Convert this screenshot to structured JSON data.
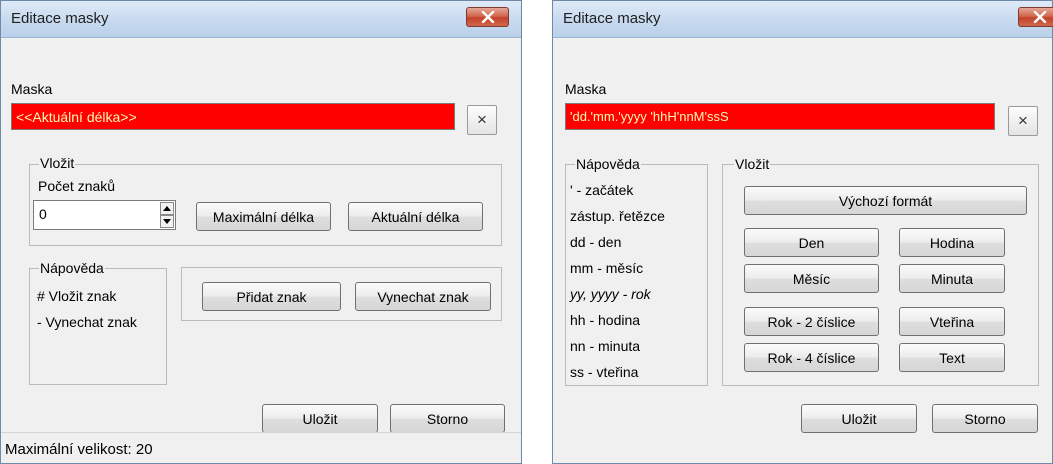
{
  "left_dialog": {
    "title": "Editace masky",
    "mask_label": "Maska",
    "mask_value": "<<Aktuální délka>>",
    "clear_button": "×",
    "insert_group": {
      "legend": "Vložit",
      "count_label": "Počet znaků",
      "count_value": "0",
      "max_length_button": "Maximální délka",
      "current_length_button": "Aktuální délka"
    },
    "help_group": {
      "legend": "Nápověda",
      "lines": [
        "# Vložit znak",
        "- Vynechat znak"
      ]
    },
    "add_char_button": "Přidat znak",
    "skip_char_button": "Vynechat znak",
    "save_button": "Uložit",
    "cancel_button": "Storno",
    "status_text": "Maximální velikost: 20"
  },
  "right_dialog": {
    "title": "Editace masky",
    "mask_label": "Maska",
    "mask_value": "'dd.'mm.'yyyy 'hhH'nnM'ssS",
    "clear_button": "×",
    "help_group": {
      "legend": "Nápověda",
      "lines": [
        "' - začátek",
        "zástup. řetězce",
        "dd - den",
        "mm - měsíc",
        "yy, yyyy - rok",
        "hh - hodina",
        "nn - minuta",
        "ss - vteřina"
      ]
    },
    "insert_group": {
      "legend": "Vložit",
      "default_format_button": "Výchozí formát",
      "buttons": {
        "den": "Den",
        "hodina": "Hodina",
        "mesic": "Měsíc",
        "minuta": "Minuta",
        "rok2": "Rok - 2 číslice",
        "vterina": "Vteřina",
        "rok4": "Rok - 4 číslice",
        "text": "Text"
      }
    },
    "save_button": "Uložit",
    "cancel_button": "Storno"
  },
  "colors": {
    "mask_field_bg": "#ff0000",
    "mask_field_text": "#fff7b0",
    "close_button": "#c7472e"
  }
}
